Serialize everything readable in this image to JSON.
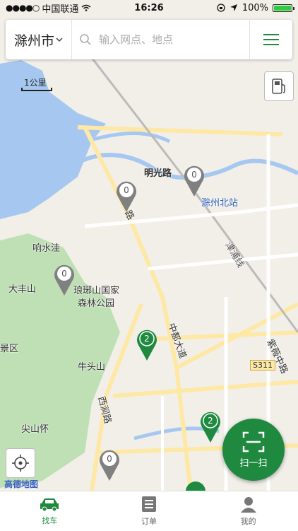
{
  "status_bar": {
    "carrier": "中国联通",
    "time": "16:26",
    "battery": "100%"
  },
  "search": {
    "city": "滁州市",
    "placeholder": "输入网点、地点"
  },
  "map": {
    "scale": "1公里",
    "logo": "高德地图",
    "labels": {
      "mingguang": "明光路",
      "north_station": "滁州北站",
      "xiangshui": "响水洼",
      "dafeng": "大丰山",
      "langya_1": "琅琊山国家",
      "langya_2": "森林公园",
      "jingqu": "景区",
      "niutou": "牛头山",
      "jianshan": "尖山怀",
      "zhongdu": "中都大道",
      "xijian": "西涧路",
      "ziwei": "紫薇中路",
      "s311": "S311",
      "jinpu": "津浦线",
      "lu": "路",
      "da": "大"
    },
    "pins": [
      {
        "count": "0",
        "color": "gray"
      },
      {
        "count": "0",
        "color": "gray"
      },
      {
        "count": "0",
        "color": "gray"
      },
      {
        "count": "2",
        "color": "green"
      },
      {
        "count": "2",
        "color": "green"
      },
      {
        "count": "0",
        "color": "gray"
      },
      {
        "count": "",
        "color": "green"
      }
    ]
  },
  "scan": {
    "label": "扫一扫"
  },
  "tabs": [
    {
      "label": "找车"
    },
    {
      "label": "订单"
    },
    {
      "label": "我的"
    }
  ],
  "colors": {
    "accent": "#1f8a3f",
    "water": "#a6c8f0",
    "park": "#bfe0b5"
  }
}
